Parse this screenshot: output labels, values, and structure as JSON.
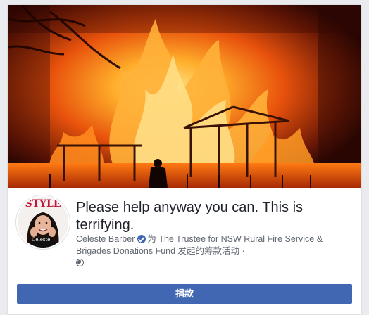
{
  "fundraiser": {
    "title": "Please help anyway you can. This is terrifying.",
    "organizer": "Celeste Barber",
    "description": "为 The Trustee for NSW Rural Fire Service & Brigades Donations Fund 发起的筹款活动 ·",
    "donate_label": "捐款",
    "avatar_text": "Celeste",
    "privacy_icon": "globe-icon",
    "verified_icon": "verified-badge-icon"
  },
  "colors": {
    "brand_blue": "#4267b2",
    "meta_gray": "#606770",
    "title_text": "#1d2129"
  }
}
